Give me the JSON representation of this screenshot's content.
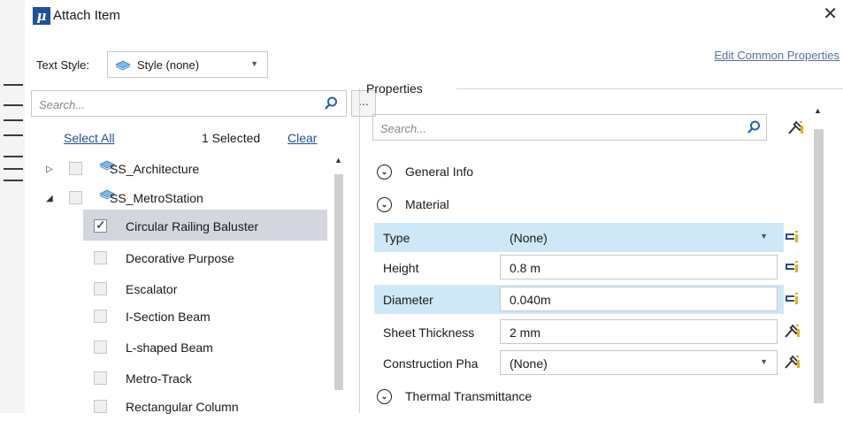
{
  "window": {
    "title": "Attach Item",
    "close_glyph": "✕",
    "app_icon_glyph": "μ"
  },
  "header": {
    "edit_common_properties": "Edit Common Properties"
  },
  "text_style": {
    "label": "Text Style:",
    "value": "Style (none)"
  },
  "left_panel": {
    "search_placeholder": "Search...",
    "more_button": "...",
    "select_all": "Select All",
    "selected_count": "1 Selected",
    "clear": "Clear",
    "tree": [
      {
        "label": "SS_Architecture",
        "expanded": false
      },
      {
        "label": "SS_MetroStation",
        "expanded": true,
        "children": [
          {
            "label": "Circular Railing Baluster",
            "checked": true,
            "selected": true
          },
          {
            "label": "Decorative Purpose",
            "checked": false
          },
          {
            "label": "Escalator",
            "checked": false
          },
          {
            "label": "I-Section Beam",
            "checked": false
          },
          {
            "label": "L-shaped Beam",
            "checked": false
          },
          {
            "label": "Metro-Track",
            "checked": false
          },
          {
            "label": "Rectangular Column",
            "checked": false
          }
        ]
      }
    ]
  },
  "properties": {
    "title": "Properties",
    "search_placeholder": "Search...",
    "sections": {
      "general_info": "General Info",
      "material": "Material",
      "thermal": "Thermal Transmittance"
    },
    "rows": [
      {
        "name": "Type",
        "value": "(None)",
        "dropdown": true,
        "highlighted": true
      },
      {
        "name": "Height",
        "value": "0.8 m",
        "dropdown": false,
        "highlighted": false
      },
      {
        "name": "Diameter",
        "value": "0.040m",
        "dropdown": false,
        "highlighted": true
      },
      {
        "name": "Sheet Thickness",
        "value": "2 mm",
        "dropdown": false,
        "highlighted": false
      },
      {
        "name": "Construction Pha",
        "value": "(None)",
        "dropdown": true,
        "highlighted": false
      }
    ]
  },
  "colors": {
    "accent": "#1f4f9f",
    "highlight": "#cfe8f7",
    "selected_row": "#d3d5df"
  }
}
